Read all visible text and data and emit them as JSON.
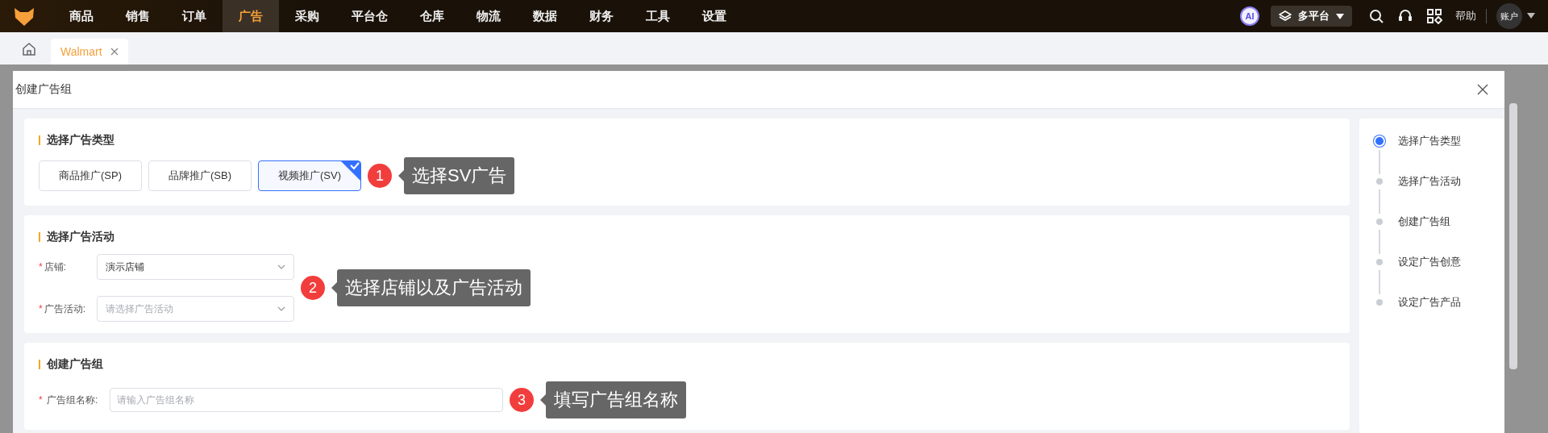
{
  "nav": {
    "items": [
      {
        "label": "商品",
        "selected": false
      },
      {
        "label": "销售",
        "selected": false
      },
      {
        "label": "订单",
        "selected": false
      },
      {
        "label": "广告",
        "selected": true
      },
      {
        "label": "采购",
        "selected": false
      },
      {
        "label": "平台仓",
        "selected": false
      },
      {
        "label": "仓库",
        "selected": false
      },
      {
        "label": "物流",
        "selected": false
      },
      {
        "label": "数据",
        "selected": false
      },
      {
        "label": "财务",
        "selected": false
      },
      {
        "label": "工具",
        "selected": false
      },
      {
        "label": "设置",
        "selected": false
      }
    ],
    "ai_label": "AI",
    "platform": "多平台",
    "help": "帮助",
    "account": "账户"
  },
  "tabs": [
    {
      "label": "Walmart",
      "selected": true
    }
  ],
  "dialog": {
    "title": "创建广告组",
    "ad_type": {
      "title": "选择广告类型",
      "options": [
        {
          "label": "商品推广(SP)",
          "selected": false
        },
        {
          "label": "品牌推广(SB)",
          "selected": false
        },
        {
          "label": "视频推广(SV)",
          "selected": true
        }
      ]
    },
    "campaign": {
      "title": "选择广告活动",
      "fields": [
        {
          "label": "店铺:",
          "required_mark": "*",
          "value": "演示店铺"
        },
        {
          "label": "广告活动:",
          "required_mark": "*",
          "placeholder": "请选择广告活动"
        }
      ]
    },
    "ad_group": {
      "title": "创建广告组",
      "fields": [
        {
          "label": "广告组名称:",
          "required_mark": "*",
          "placeholder": "请输入广告组名称"
        }
      ]
    },
    "steps": [
      {
        "label": "选择广告类型",
        "selected": true
      },
      {
        "label": "选择广告活动",
        "selected": false
      },
      {
        "label": "创建广告组",
        "selected": false
      },
      {
        "label": "设定广告创意",
        "selected": false
      },
      {
        "label": "设定广告产品",
        "selected": false
      }
    ]
  },
  "annotations": [
    {
      "number": "1",
      "text": "选择SV广告"
    },
    {
      "number": "2",
      "text": "选择店铺以及广告活动"
    },
    {
      "number": "3",
      "text": "填写广告组名称"
    }
  ]
}
